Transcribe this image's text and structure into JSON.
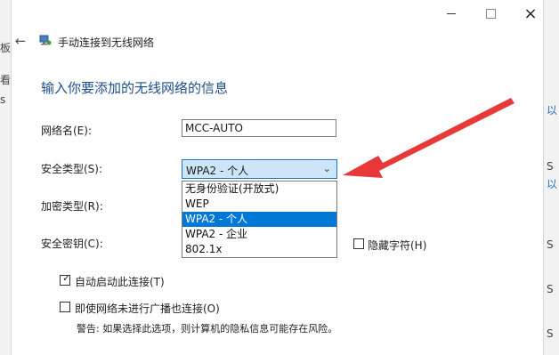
{
  "window": {
    "title": "手动连接到无线网络",
    "controls": {
      "minimize": "minimize",
      "maximize": "maximize",
      "close": "×"
    }
  },
  "heading": "输入你要添加的无线网络的信息",
  "fields": {
    "network_name": {
      "label": "网络名(E):",
      "value": "MCC-AUTO"
    },
    "security_type": {
      "label": "安全类型(S):",
      "value": "WPA2 - 个人"
    },
    "encryption_type": {
      "label": "加密类型(R):"
    },
    "security_key": {
      "label": "安全密钥(C):"
    }
  },
  "dropdown_options": [
    {
      "label": "无身份验证(开放式)",
      "selected": false
    },
    {
      "label": "WEP",
      "selected": false
    },
    {
      "label": "WPA2 - 个人",
      "selected": true
    },
    {
      "label": "WPA2 - 企业",
      "selected": false
    },
    {
      "label": "802.1x",
      "selected": false
    }
  ],
  "checkboxes": {
    "hide_chars": {
      "label": "隐藏字符(H)",
      "checked": false
    },
    "auto_start": {
      "label": "自动启动此连接(T)",
      "checked": true
    },
    "connect_hidden": {
      "label": "即使网络未进行广播也连接(O)",
      "checked": false
    }
  },
  "warning": "警告: 如果选择此选项，则计算机的隐私信息可能存在风险。",
  "background": {
    "left_chars": [
      "板",
      "看",
      "s"
    ],
    "right_chars": [
      "以",
      "S",
      "以",
      "S",
      "S",
      "S"
    ]
  },
  "colors": {
    "accent": "#0078d7",
    "heading": "#1e4e8c",
    "annotation_arrow": "#e8393a"
  }
}
